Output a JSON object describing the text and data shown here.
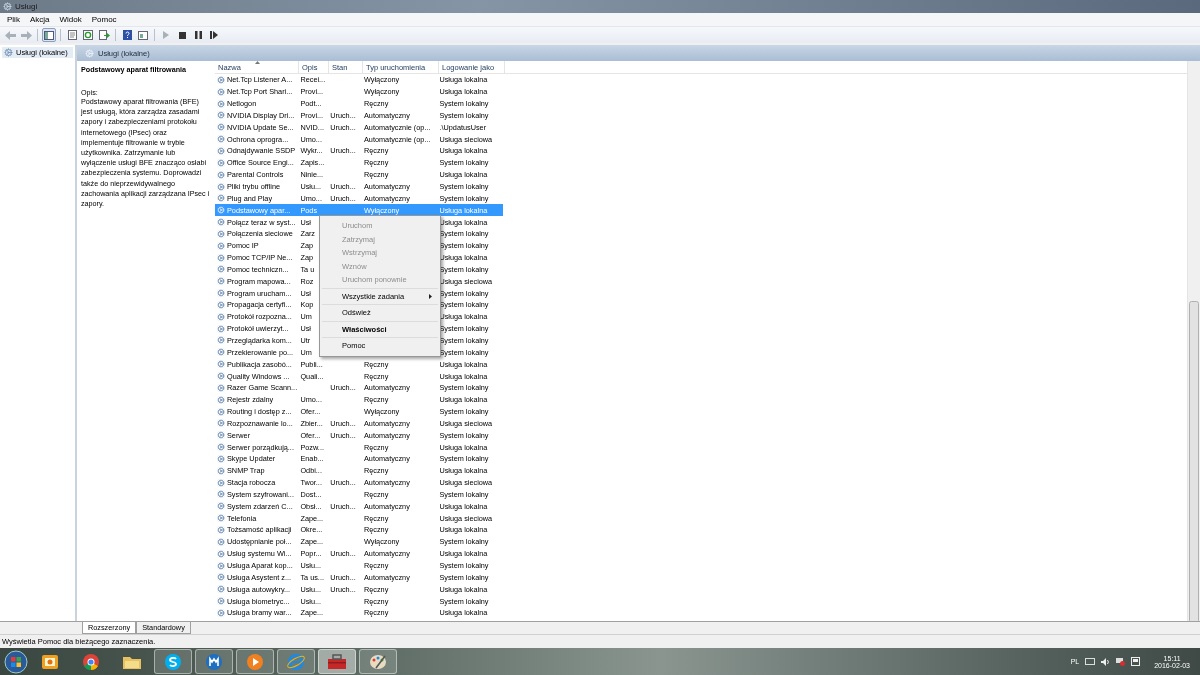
{
  "window": {
    "title": "Usługi"
  },
  "menu": [
    "Plik",
    "Akcja",
    "Widok",
    "Pomoc"
  ],
  "toolbar": [
    {
      "kind": "back",
      "disabled": true
    },
    {
      "kind": "forward",
      "disabled": true
    },
    {
      "kind": "sep"
    },
    {
      "kind": "tree",
      "pressed": true
    },
    {
      "kind": "sep"
    },
    {
      "kind": "properties"
    },
    {
      "kind": "refresh"
    },
    {
      "kind": "export"
    },
    {
      "kind": "sep"
    },
    {
      "kind": "help"
    },
    {
      "kind": "view"
    },
    {
      "kind": "sep"
    },
    {
      "kind": "play",
      "disabled": true
    },
    {
      "kind": "stop"
    },
    {
      "kind": "pause"
    },
    {
      "kind": "restart"
    }
  ],
  "tree": {
    "items": [
      {
        "label": "Usługi (lokalne)",
        "selected": true
      }
    ]
  },
  "panel": {
    "title": "Usługi (lokalne)"
  },
  "details": {
    "title": "Podstawowy aparat filtrowania",
    "label": "Opis:",
    "text": "Podstawowy aparat filtrowania (BFE) jest usługą, która zarządza zasadami zapory i zabezpieczeniami protokołu internetowego (IPsec) oraz implementuje filtrowanie w trybie użytkownika. Zatrzymanie lub wyłączenie usługi BFE znacząco osłabi zabezpieczenia systemu. Doprowadzi także do nieprzewidywalnego zachowania aplikacji zarządzana IPsec i zapory."
  },
  "table": {
    "columns": [
      {
        "label": "Nazwa",
        "sorted": true
      },
      {
        "label": "Opis",
        "sorted": false
      },
      {
        "label": "Stan",
        "sorted": false
      },
      {
        "label": "Typ uruchomienia",
        "sorted": false
      },
      {
        "label": "Logowanie jako",
        "sorted": false
      }
    ],
    "rows": [
      {
        "cells": [
          "Net.Tcp Listener A...",
          "Recei...",
          "",
          "Wyłączony",
          "Usługa lokalna"
        ],
        "selected": false
      },
      {
        "cells": [
          "Net.Tcp Port Shari...",
          "Provi...",
          "",
          "Wyłączony",
          "Usługa lokalna"
        ],
        "selected": false
      },
      {
        "cells": [
          "Netlogon",
          "Podt...",
          "",
          "Ręczny",
          "System lokalny"
        ],
        "selected": false
      },
      {
        "cells": [
          "NVIDIA Display Dri...",
          "Provi...",
          "Uruch...",
          "Automatyczny",
          "System lokalny"
        ],
        "selected": false
      },
      {
        "cells": [
          "NVIDIA Update Se...",
          "NVID...",
          "Uruch...",
          "Automatycznie (op...",
          ".\\UpdatusUser"
        ],
        "selected": false
      },
      {
        "cells": [
          "Ochrona oprogra...",
          "Umo...",
          "",
          "Automatycznie (op...",
          "Usługa sieciowa"
        ],
        "selected": false
      },
      {
        "cells": [
          "Odnajdywanie SSDP",
          "Wykr...",
          "Uruch...",
          "Ręczny",
          "Usługa lokalna"
        ],
        "selected": false
      },
      {
        "cells": [
          "Office Source Engi...",
          "Zapis...",
          "",
          "Ręczny",
          "System lokalny"
        ],
        "selected": false
      },
      {
        "cells": [
          "Parental Controls",
          "Ninie...",
          "",
          "Ręczny",
          "Usługa lokalna"
        ],
        "selected": false
      },
      {
        "cells": [
          "Pliki trybu offline",
          "Usłu...",
          "Uruch...",
          "Automatyczny",
          "System lokalny"
        ],
        "selected": false
      },
      {
        "cells": [
          "Plug and Play",
          "Umo...",
          "Uruch...",
          "Automatyczny",
          "System lokalny"
        ],
        "selected": false
      },
      {
        "cells": [
          "Podstawowy apar...",
          "Pods",
          "",
          "Wyłączony",
          "Usługa lokalna"
        ],
        "selected": true
      },
      {
        "cells": [
          "Połącz teraz w syst...",
          "Usł",
          "",
          "",
          "Usługa lokalna"
        ],
        "selected": false
      },
      {
        "cells": [
          "Połączenia sieciowe",
          "Zarz",
          "",
          "",
          "System lokalny"
        ],
        "selected": false
      },
      {
        "cells": [
          "Pomoc IP",
          "Zap",
          "",
          "",
          "System lokalny"
        ],
        "selected": false
      },
      {
        "cells": [
          "Pomoc TCP/IP Ne...",
          "Zap",
          "",
          "",
          "Usługa lokalna"
        ],
        "selected": false
      },
      {
        "cells": [
          "Pomoc techniczn...",
          "Ta u",
          "",
          "",
          "System lokalny"
        ],
        "selected": false
      },
      {
        "cells": [
          "Program mapowa...",
          "Roz",
          "",
          "",
          "Usługa sieciowa"
        ],
        "selected": false
      },
      {
        "cells": [
          "Program urucham...",
          "Usł",
          "",
          "",
          "System lokalny"
        ],
        "selected": false
      },
      {
        "cells": [
          "Propagacja certyfi...",
          "Kop",
          "",
          "",
          "System lokalny"
        ],
        "selected": false
      },
      {
        "cells": [
          "Protokół rozpozna...",
          "Um",
          "",
          "",
          "Usługa lokalna"
        ],
        "selected": false
      },
      {
        "cells": [
          "Protokół uwierzyt...",
          "Usł",
          "",
          "",
          "System lokalny"
        ],
        "selected": false
      },
      {
        "cells": [
          "Przeglądarka kom...",
          "Utr",
          "",
          "",
          "System lokalny"
        ],
        "selected": false
      },
      {
        "cells": [
          "Przekierowanie po...",
          "Um",
          "",
          "",
          "System lokalny"
        ],
        "selected": false
      },
      {
        "cells": [
          "Publikacja zasobó...",
          "Publi...",
          "",
          "Ręczny",
          "Usługa lokalna"
        ],
        "selected": false
      },
      {
        "cells": [
          "Quality Windows ...",
          "Quali...",
          "",
          "Ręczny",
          "Usługa lokalna"
        ],
        "selected": false
      },
      {
        "cells": [
          "Razer Game Scann...",
          "",
          "Uruch...",
          "Automatyczny",
          "System lokalny"
        ],
        "selected": false
      },
      {
        "cells": [
          "Rejestr zdalny",
          "Umo...",
          "",
          "Ręczny",
          "Usługa lokalna"
        ],
        "selected": false
      },
      {
        "cells": [
          "Routing i dostęp z...",
          "Ofer...",
          "",
          "Wyłączony",
          "System lokalny"
        ],
        "selected": false
      },
      {
        "cells": [
          "Rozpoznawanie lo...",
          "Zbier...",
          "Uruch...",
          "Automatyczny",
          "Usługa sieciowa"
        ],
        "selected": false
      },
      {
        "cells": [
          "Serwer",
          "Ofer...",
          "Uruch...",
          "Automatyczny",
          "System lokalny"
        ],
        "selected": false
      },
      {
        "cells": [
          "Serwer porządkują...",
          "Pozw...",
          "",
          "Ręczny",
          "Usługa lokalna"
        ],
        "selected": false
      },
      {
        "cells": [
          "Skype Updater",
          "Enab...",
          "",
          "Automatyczny",
          "System lokalny"
        ],
        "selected": false
      },
      {
        "cells": [
          "SNMP Trap",
          "Odbi...",
          "",
          "Ręczny",
          "Usługa lokalna"
        ],
        "selected": false
      },
      {
        "cells": [
          "Stacja robocza",
          "Twor...",
          "Uruch...",
          "Automatyczny",
          "Usługa sieciowa"
        ],
        "selected": false
      },
      {
        "cells": [
          "System szyfrowani...",
          "Dost...",
          "",
          "Ręczny",
          "System lokalny"
        ],
        "selected": false
      },
      {
        "cells": [
          "System zdarzeń C...",
          "Obsł...",
          "Uruch...",
          "Automatyczny",
          "Usługa lokalna"
        ],
        "selected": false
      },
      {
        "cells": [
          "Telefonia",
          "Zape...",
          "",
          "Ręczny",
          "Usługa sieciowa"
        ],
        "selected": false
      },
      {
        "cells": [
          "Tożsamość aplikacji",
          "Okre...",
          "",
          "Ręczny",
          "Usługa lokalna"
        ],
        "selected": false
      },
      {
        "cells": [
          "Udostępnianie poł...",
          "Zape...",
          "",
          "Wyłączony",
          "System lokalny"
        ],
        "selected": false
      },
      {
        "cells": [
          "Usług systemu Wi...",
          "Popr...",
          "Uruch...",
          "Automatyczny",
          "Usługa lokalna"
        ],
        "selected": false
      },
      {
        "cells": [
          "Usługa Aparat kop...",
          "Usłu...",
          "",
          "Ręczny",
          "System lokalny"
        ],
        "selected": false
      },
      {
        "cells": [
          "Usługa Asystent z...",
          "Ta us...",
          "Uruch...",
          "Automatyczny",
          "System lokalny"
        ],
        "selected": false
      },
      {
        "cells": [
          "Usługa autowykry...",
          "Usłu...",
          "Uruch...",
          "Ręczny",
          "Usługa lokalna"
        ],
        "selected": false
      },
      {
        "cells": [
          "Usługa biometryc...",
          "Usłu...",
          "",
          "Ręczny",
          "System lokalny"
        ],
        "selected": false
      },
      {
        "cells": [
          "Usługa bramy war...",
          "Zape...",
          "",
          "Ręczny",
          "Usługa lokalna"
        ],
        "selected": false
      }
    ]
  },
  "context_menu": {
    "groups": [
      [
        {
          "label": "Uruchom",
          "disabled": true
        },
        {
          "label": "Zatrzymaj",
          "disabled": true
        },
        {
          "label": "Wstrzymaj",
          "disabled": true
        },
        {
          "label": "Wznów",
          "disabled": true
        },
        {
          "label": "Uruchom ponownie",
          "disabled": true
        }
      ],
      [
        {
          "label": "Wszystkie zadania",
          "disabled": false,
          "submenu": true
        }
      ],
      [
        {
          "label": "Odśwież",
          "disabled": false
        }
      ],
      [
        {
          "label": "Właściwości",
          "disabled": false,
          "default": true
        }
      ],
      [
        {
          "label": "Pomoc",
          "disabled": false
        }
      ]
    ]
  },
  "tabs": [
    {
      "label": "Rozszerzony",
      "selected": true
    },
    {
      "label": "Standardowy",
      "selected": false
    }
  ],
  "status_bar": "Wyświetla Pomoc dla bieżącego zaznaczenia.",
  "taskbar": {
    "apps": [
      {
        "kind": "outlook",
        "running": false
      },
      {
        "kind": "chrome",
        "running": false
      },
      {
        "kind": "folder",
        "running": false
      },
      {
        "kind": "skype",
        "running": true
      },
      {
        "kind": "maxthon",
        "running": true
      },
      {
        "kind": "media",
        "running": true
      },
      {
        "kind": "ie",
        "running": true
      },
      {
        "kind": "toolbox",
        "running": true,
        "active": true
      },
      {
        "kind": "paint",
        "running": true
      }
    ],
    "language": "PL",
    "time": "15:11",
    "date": "2016-02-03"
  }
}
